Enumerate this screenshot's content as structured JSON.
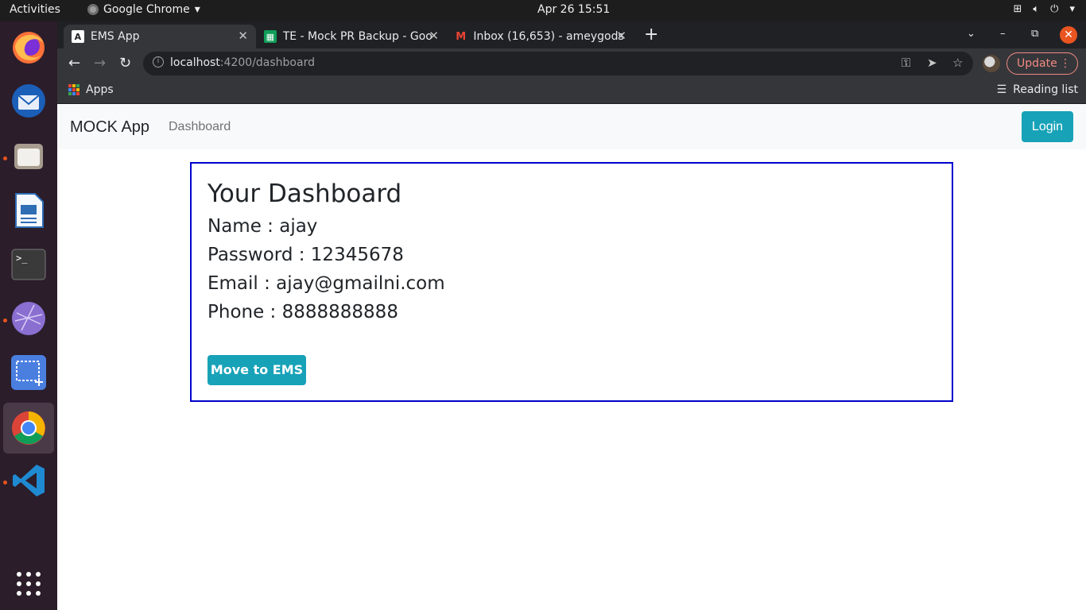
{
  "system": {
    "activities": "Activities",
    "app_menu": "Google Chrome",
    "clock": "Apr 26  15:51"
  },
  "browser": {
    "tabs": [
      {
        "title": "EMS App",
        "favicon": "angular-icon",
        "active": true
      },
      {
        "title": "TE - Mock PR Backup - Goo",
        "favicon": "sheets-icon",
        "active": false
      },
      {
        "title": "Inbox (16,653) - ameygods",
        "favicon": "gmail-icon",
        "active": false
      }
    ],
    "url_host": "localhost",
    "url_path": ":4200/dashboard",
    "update_label": "Update",
    "bookmarks": {
      "apps_label": "Apps",
      "reading_list_label": "Reading list"
    }
  },
  "app": {
    "brand": "MOCK App",
    "nav_link": "Dashboard",
    "login_label": "Login",
    "dashboard": {
      "title": "Your Dashboard",
      "name": "Name : ajay",
      "password": "Password : 12345678",
      "email": "Email : ajay@gmailni.com",
      "phone": "Phone : 8888888888",
      "move_button": "Move to EMS"
    }
  },
  "colors": {
    "accent": "#17a2b8",
    "card_border": "#0000cc",
    "ubuntu_orange": "#e95420"
  }
}
